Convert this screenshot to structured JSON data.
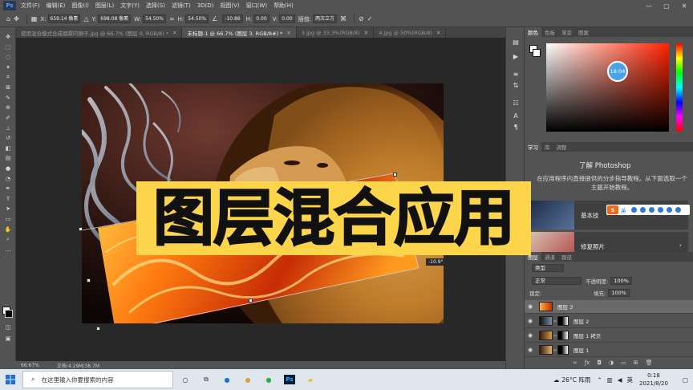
{
  "menu": {
    "logo": "Ps",
    "items": [
      "文件(F)",
      "编辑(E)",
      "图像(I)",
      "图层(L)",
      "文字(Y)",
      "选择(S)",
      "滤镜(T)",
      "3D(D)",
      "视图(V)",
      "窗口(W)",
      "帮助(H)"
    ],
    "controls": [
      "—",
      "▢",
      "✕"
    ]
  },
  "options": {
    "x_label": "X:",
    "x_value": "659.14 像素",
    "y_label": "Y:",
    "y_value": "698.08 像素",
    "w_label": "W:",
    "w_value": "54.50%",
    "h_label": "H:",
    "h_value": "54.50%",
    "angle_value": "-10.86",
    "hskew_label": "H:",
    "hskew_value": "0.00",
    "vskew_label": "V:",
    "vskew_value": "0.00",
    "interp_label": "插值:",
    "interp_value": "两次立方"
  },
  "tabs": [
    {
      "label": "使用混合模式合成烟雾的狮子.jpg @ 66.7% (图层 0, RGB/8) *",
      "active": false
    },
    {
      "label": "未标题-1 @ 66.7% (图层 3, RGB/8#) *",
      "active": true
    },
    {
      "label": "3.jpg @ 33.3%(RGB/8)",
      "active": false
    },
    {
      "label": "4.jpg @ 50%(RGB/8)",
      "active": false
    }
  ],
  "tab_close": "✕",
  "title_text": "图层混合应用",
  "transform_angle": "-10.9°",
  "status": {
    "zoom": "66.67%",
    "doc": "文档:4.29M/38.7M"
  },
  "color_panel": {
    "tabs": [
      "颜色",
      "色板",
      "渐变",
      "图案"
    ],
    "picker_value": "18:04"
  },
  "learn_panel": {
    "tabs": [
      "学习",
      "库",
      "调整"
    ],
    "title": "了解 Photoshop",
    "desc": "在应用程序内直接提供的分步指导教程。从下面选取一个主题开始教程。",
    "cards": [
      {
        "label": "基本技"
      },
      {
        "label": "修复照片"
      }
    ],
    "arrow": "›"
  },
  "ime": {
    "s": "S",
    "lang": "英"
  },
  "layers_panel": {
    "tabs": [
      "图层",
      "通道",
      "路径"
    ],
    "search": "类型",
    "blend_mode": "正常",
    "opacity_label": "不透明度:",
    "opacity": "100%",
    "lock_label": "锁定:",
    "fill_label": "填充:",
    "fill": "100%",
    "layers": [
      {
        "name": "图层 3",
        "selected": true
      },
      {
        "name": "图层 2",
        "selected": false
      },
      {
        "name": "图层 1 拷贝",
        "selected": false
      },
      {
        "name": "图层 1",
        "selected": false
      }
    ]
  },
  "taskbar": {
    "search_placeholder": "在这里输入你要搜索的内容",
    "weather": "26°C 阵雨",
    "ime": "英",
    "time": "0:18",
    "date": "2021/8/20"
  }
}
